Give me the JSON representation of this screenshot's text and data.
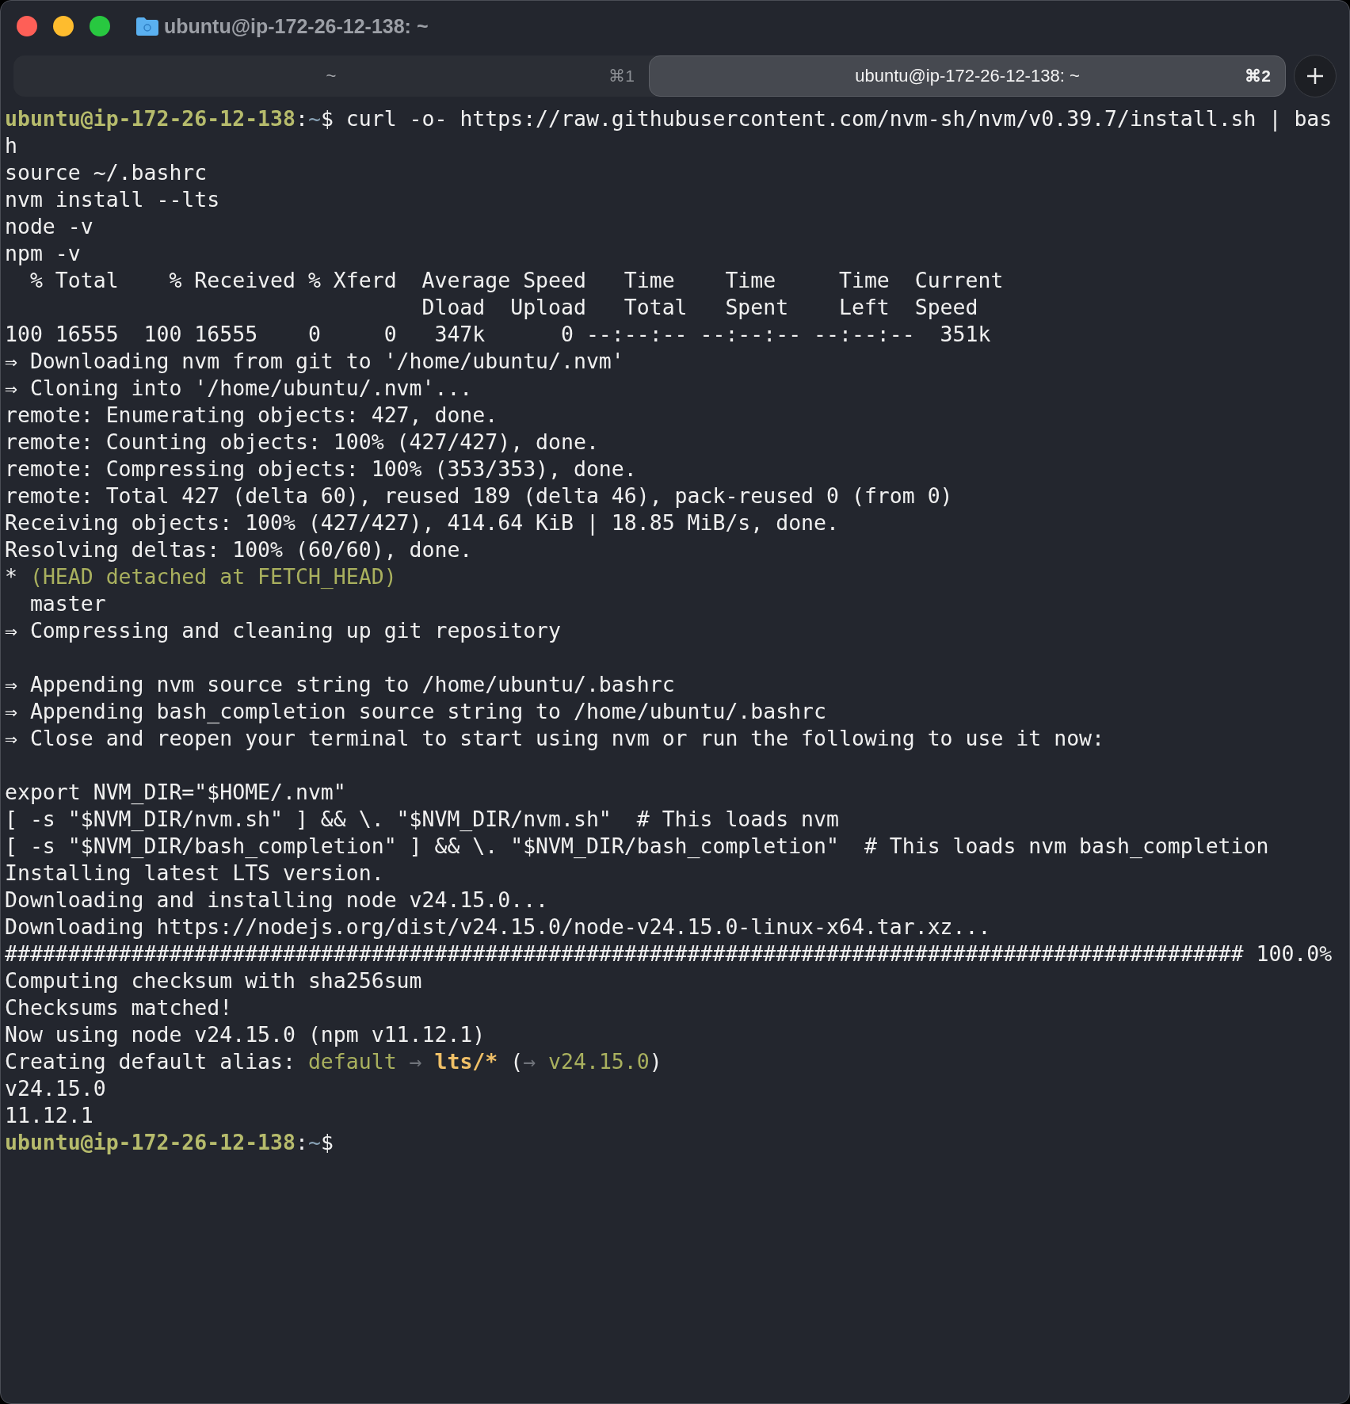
{
  "window": {
    "title": "ubuntu@ip-172-26-12-138: ~"
  },
  "tabs": [
    {
      "label": "~",
      "shortcut": "⌘1",
      "selected": false
    },
    {
      "label": "ubuntu@ip-172-26-12-138: ~",
      "shortcut": "⌘2",
      "selected": true
    }
  ],
  "lines": [
    {
      "kind": "text",
      "segments": [
        {
          "kind": "user",
          "text": "ubuntu@ip-172-26-12-138"
        },
        {
          "kind": "plain",
          "text": ":"
        },
        {
          "kind": "path",
          "text": "~"
        },
        {
          "kind": "plain",
          "text": "$ curl -o- https://raw.githubusercontent.com/nvm-sh/nvm/v0.39.7/install.sh | bas"
        }
      ]
    },
    {
      "kind": "text",
      "segments": [
        {
          "kind": "plain",
          "text": "h"
        }
      ]
    },
    {
      "kind": "text",
      "segments": [
        {
          "kind": "plain",
          "text": "source ~/.bashrc"
        }
      ]
    },
    {
      "kind": "text",
      "segments": [
        {
          "kind": "plain",
          "text": "nvm install --lts"
        }
      ]
    },
    {
      "kind": "text",
      "segments": [
        {
          "kind": "plain",
          "text": "node -v"
        }
      ]
    },
    {
      "kind": "text",
      "segments": [
        {
          "kind": "plain",
          "text": "npm -v"
        }
      ]
    },
    {
      "kind": "text",
      "segments": [
        {
          "kind": "plain",
          "text": "  % Total    % Received % Xferd  Average Speed   Time    Time     Time  Current"
        }
      ]
    },
    {
      "kind": "text",
      "segments": [
        {
          "kind": "plain",
          "text": "                                 Dload  Upload   Total   Spent    Left  Speed"
        }
      ]
    },
    {
      "kind": "text",
      "segments": [
        {
          "kind": "plain",
          "text": "100 16555  100 16555    0     0   347k      0 --:--:-- --:--:-- --:--:--  351k"
        }
      ]
    },
    {
      "kind": "text",
      "segments": [
        {
          "kind": "plain",
          "text": "⇒ Downloading nvm from git to '/home/ubuntu/.nvm'"
        }
      ]
    },
    {
      "kind": "text",
      "segments": [
        {
          "kind": "plain",
          "text": "⇒ Cloning into '/home/ubuntu/.nvm'..."
        }
      ]
    },
    {
      "kind": "text",
      "segments": [
        {
          "kind": "plain",
          "text": "remote: Enumerating objects: 427, done."
        }
      ]
    },
    {
      "kind": "text",
      "segments": [
        {
          "kind": "plain",
          "text": "remote: Counting objects: 100% (427/427), done."
        }
      ]
    },
    {
      "kind": "text",
      "segments": [
        {
          "kind": "plain",
          "text": "remote: Compressing objects: 100% (353/353), done."
        }
      ]
    },
    {
      "kind": "text",
      "segments": [
        {
          "kind": "plain",
          "text": "remote: Total 427 (delta 60), reused 189 (delta 46), pack-reused 0 (from 0)"
        }
      ]
    },
    {
      "kind": "text",
      "segments": [
        {
          "kind": "plain",
          "text": "Receiving objects: 100% (427/427), 414.64 KiB | 18.85 MiB/s, done."
        }
      ]
    },
    {
      "kind": "text",
      "segments": [
        {
          "kind": "plain",
          "text": "Resolving deltas: 100% (60/60), done."
        }
      ]
    },
    {
      "kind": "text",
      "segments": [
        {
          "kind": "plain",
          "text": "* "
        },
        {
          "kind": "accent",
          "text": "(HEAD detached at FETCH_HEAD)"
        }
      ]
    },
    {
      "kind": "text",
      "segments": [
        {
          "kind": "plain",
          "text": "  master"
        }
      ]
    },
    {
      "kind": "text",
      "segments": [
        {
          "kind": "plain",
          "text": "⇒ Compressing and cleaning up git repository"
        }
      ]
    },
    {
      "kind": "blank"
    },
    {
      "kind": "text",
      "segments": [
        {
          "kind": "plain",
          "text": "⇒ Appending nvm source string to /home/ubuntu/.bashrc"
        }
      ]
    },
    {
      "kind": "text",
      "segments": [
        {
          "kind": "plain",
          "text": "⇒ Appending bash_completion source string to /home/ubuntu/.bashrc"
        }
      ]
    },
    {
      "kind": "text",
      "segments": [
        {
          "kind": "plain",
          "text": "⇒ Close and reopen your terminal to start using nvm or run the following to use it now:"
        }
      ]
    },
    {
      "kind": "blank"
    },
    {
      "kind": "text",
      "segments": [
        {
          "kind": "plain",
          "text": "export NVM_DIR=\"$HOME/.nvm\""
        }
      ]
    },
    {
      "kind": "text",
      "segments": [
        {
          "kind": "plain",
          "text": "[ -s \"$NVM_DIR/nvm.sh\" ] && \\. \"$NVM_DIR/nvm.sh\"  # This loads nvm"
        }
      ]
    },
    {
      "kind": "text",
      "segments": [
        {
          "kind": "plain",
          "text": "[ -s \"$NVM_DIR/bash_completion\" ] && \\. \"$NVM_DIR/bash_completion\"  # This loads nvm bash_completion"
        }
      ]
    },
    {
      "kind": "text",
      "segments": [
        {
          "kind": "plain",
          "text": "Installing latest LTS version."
        }
      ]
    },
    {
      "kind": "text",
      "segments": [
        {
          "kind": "plain",
          "text": "Downloading and installing node v24.15.0..."
        }
      ]
    },
    {
      "kind": "text",
      "segments": [
        {
          "kind": "plain",
          "text": "Downloading https://nodejs.org/dist/v24.15.0/node-v24.15.0-linux-x64.tar.xz..."
        }
      ]
    },
    {
      "kind": "text",
      "segments": [
        {
          "kind": "plain",
          "text": "################################################################################################## 100.0%"
        }
      ]
    },
    {
      "kind": "text",
      "segments": [
        {
          "kind": "plain",
          "text": "Computing checksum with sha256sum"
        }
      ]
    },
    {
      "kind": "text",
      "segments": [
        {
          "kind": "plain",
          "text": "Checksums matched!"
        }
      ]
    },
    {
      "kind": "text",
      "segments": [
        {
          "kind": "plain",
          "text": "Now using node v24.15.0 (npm v11.12.1)"
        }
      ]
    },
    {
      "kind": "text",
      "segments": [
        {
          "kind": "plain",
          "text": "Creating default alias: "
        },
        {
          "kind": "accent",
          "text": "default"
        },
        {
          "kind": "dim",
          "text": " → "
        },
        {
          "kind": "strong",
          "text": "lts/*"
        },
        {
          "kind": "plain",
          "text": " ("
        },
        {
          "kind": "dim",
          "text": "→ "
        },
        {
          "kind": "accent",
          "text": "v24.15.0"
        },
        {
          "kind": "plain",
          "text": ")"
        }
      ]
    },
    {
      "kind": "text",
      "segments": [
        {
          "kind": "plain",
          "text": "v24.15.0"
        }
      ]
    },
    {
      "kind": "text",
      "segments": [
        {
          "kind": "plain",
          "text": "11.12.1"
        }
      ]
    },
    {
      "kind": "text",
      "segments": [
        {
          "kind": "user",
          "text": "ubuntu@ip-172-26-12-138"
        },
        {
          "kind": "plain",
          "text": ":"
        },
        {
          "kind": "path",
          "text": "~"
        },
        {
          "kind": "plain",
          "text": "$"
        }
      ]
    }
  ]
}
